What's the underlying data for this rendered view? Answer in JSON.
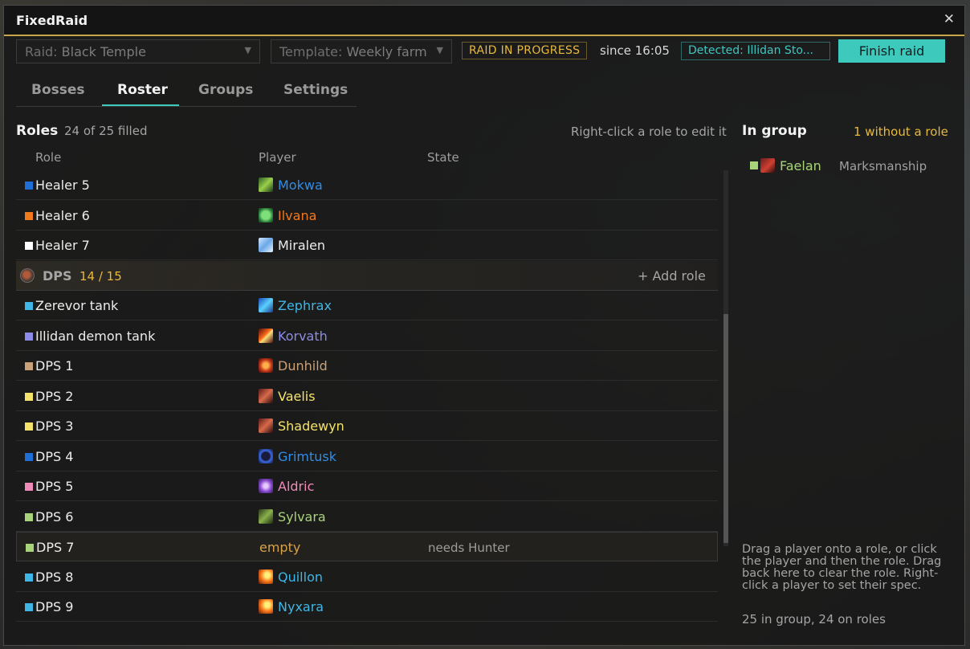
{
  "window": {
    "title": "FixedRaid"
  },
  "toolbar": {
    "raid_label": "Raid:",
    "raid_value": "Black Temple",
    "template_label": "Template:",
    "template_value": "Weekly farm",
    "status": "RAID IN PROGRESS",
    "since": "since 16:05",
    "detected": "Detected: Illidan Sto...",
    "finish_label": "Finish raid"
  },
  "tabs": [
    "Bosses",
    "Roster",
    "Groups",
    "Settings"
  ],
  "active_tab": "Roster",
  "roles": {
    "title": "Roles",
    "count": "24 of 25 filled",
    "hint": "Right-click a role to edit it",
    "columns": {
      "role": "Role",
      "player": "Player",
      "state": "State"
    },
    "rows": [
      {
        "role": "Healer 5",
        "swatch": "#1f6fd6",
        "player": "Mokwa",
        "player_color": "#2f8de8",
        "icon": "nature",
        "state": ""
      },
      {
        "role": "Healer 6",
        "swatch": "#f07a1c",
        "player": "Ilvana",
        "player_color": "#f07a1c",
        "icon": "leaf",
        "state": ""
      },
      {
        "role": "Healer 7",
        "swatch": "#ffffff",
        "player": "Miralen",
        "player_color": "#ececec",
        "icon": "holy",
        "state": ""
      }
    ],
    "section": {
      "name": "DPS",
      "count": "14 / 15",
      "add_label": "+ Add role"
    },
    "dps_rows": [
      {
        "role": "Zerevor tank",
        "swatch": "#3fb6e6",
        "player": "Zephrax",
        "player_color": "#3fb6e6",
        "icon": "frost",
        "state": ""
      },
      {
        "role": "Illidan demon tank",
        "swatch": "#8c8ce8",
        "player": "Korvath",
        "player_color": "#8c8ce8",
        "icon": "fire-slash",
        "state": ""
      },
      {
        "role": "DPS 1",
        "swatch": "#c8a07a",
        "player": "Dunhild",
        "player_color": "#c8a07a",
        "icon": "rage",
        "state": ""
      },
      {
        "role": "DPS 2",
        "swatch": "#f4e36a",
        "player": "Vaelis",
        "player_color": "#f4e36a",
        "icon": "rogue",
        "state": ""
      },
      {
        "role": "DPS 3",
        "swatch": "#f4e36a",
        "player": "Shadewyn",
        "player_color": "#f4e36a",
        "icon": "rogue",
        "state": ""
      },
      {
        "role": "DPS 4",
        "swatch": "#1f6fd6",
        "player": "Grimtusk",
        "player_color": "#2f8de8",
        "icon": "shield",
        "state": ""
      },
      {
        "role": "DPS 5",
        "swatch": "#f08ab8",
        "player": "Aldric",
        "player_color": "#f08ab8",
        "icon": "arcane",
        "state": ""
      },
      {
        "role": "DPS 6",
        "swatch": "#a8d37a",
        "player": "Sylvara",
        "player_color": "#a8d37a",
        "icon": "hunter",
        "state": ""
      },
      {
        "role": "DPS 7",
        "swatch": "#a8d37a",
        "player": "empty",
        "player_color": "#d6a24a",
        "icon": "",
        "state": "needs Hunter"
      },
      {
        "role": "DPS 8",
        "swatch": "#3fb6e6",
        "player": "Quillon",
        "player_color": "#3fb6e6",
        "icon": "fireball",
        "state": ""
      },
      {
        "role": "DPS 9",
        "swatch": "#3fb6e6",
        "player": "Nyxara",
        "player_color": "#3fb6e6",
        "icon": "fireball",
        "state": ""
      }
    ]
  },
  "group": {
    "title": "In group",
    "missing": "1 without a role",
    "members": [
      {
        "name": "Faelan",
        "spec": "Marksmanship"
      }
    ],
    "help": "Drag a player onto a role, or click the player and then the role. Drag back here to clear the role. Right-click a player to set their spec.",
    "footer": "25 in group, 24 on roles"
  }
}
